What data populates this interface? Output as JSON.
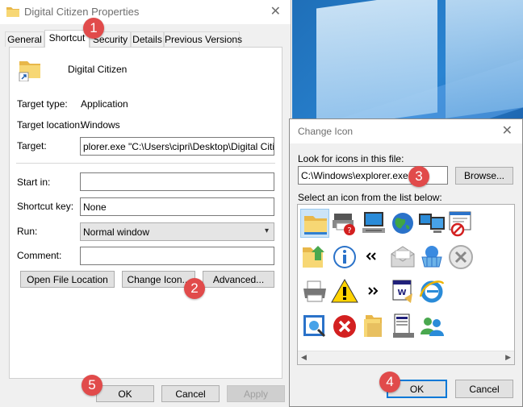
{
  "properties_dialog": {
    "title": "Digital Citizen Properties",
    "tabs": [
      "General",
      "Shortcut",
      "Security",
      "Details",
      "Previous Versions"
    ],
    "active_tab": "Shortcut",
    "shortcut_name": "Digital Citizen",
    "target_type_label": "Target type:",
    "target_type_value": "Application",
    "target_location_label": "Target location:",
    "target_location_value": "Windows",
    "target_label": "Target:",
    "target_value": "plorer.exe \"C:\\Users\\cipri\\Desktop\\Digital Citizen\"",
    "start_in_label": "Start in:",
    "start_in_value": "",
    "shortcut_key_label": "Shortcut key:",
    "shortcut_key_value": "None",
    "run_label": "Run:",
    "run_value": "Normal window",
    "comment_label": "Comment:",
    "comment_value": "",
    "open_file_location_button": "Open File Location",
    "change_icon_button": "Change Icon...",
    "advanced_button": "Advanced...",
    "ok_button": "OK",
    "cancel_button": "Cancel",
    "apply_button": "Apply"
  },
  "change_icon_dialog": {
    "title": "Change Icon",
    "look_label": "Look for icons in this file:",
    "file_value": "C:\\Windows\\explorer.exe",
    "browse_button": "Browse...",
    "select_label": "Select an icon from the list below:",
    "ok_button": "OK",
    "cancel_button": "Cancel",
    "icons": [
      "folder-icon",
      "printer-help-icon",
      "computer-icon",
      "globe-icon",
      "monitors-icon",
      "window-blocked-icon",
      "folder-up-icon",
      "info-icon",
      "double-chevron-left-icon",
      "mail-icon",
      "network-basket-icon",
      "cancel-circle-icon",
      "printer-icon",
      "warning-icon",
      "double-chevron-right-icon",
      "document-window-icon",
      "internet-explorer-icon",
      "control-panel-icon",
      "error-icon",
      "folders-icon",
      "server-icon",
      "users-icon"
    ]
  },
  "callouts": [
    "1",
    "2",
    "3",
    "4",
    "5"
  ],
  "colors": {
    "callout": "#e14b4b",
    "accent": "#0078d7",
    "selection": "#cce4f7"
  }
}
